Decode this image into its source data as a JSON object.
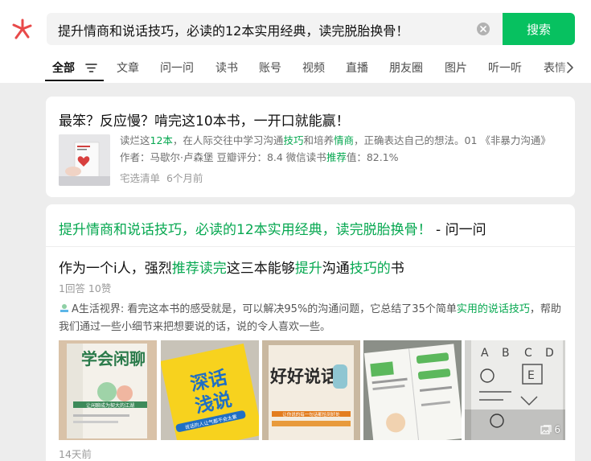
{
  "search": {
    "query": "提升情商和说话技巧，必读的12本实用经典，读完脱胎换骨！",
    "button_label": "搜索"
  },
  "tabs": [
    {
      "label": "全部",
      "active": true
    },
    {
      "label": "文章"
    },
    {
      "label": "问一问"
    },
    {
      "label": "读书"
    },
    {
      "label": "账号"
    },
    {
      "label": "视频"
    },
    {
      "label": "直播"
    },
    {
      "label": "朋友圈"
    },
    {
      "label": "图片"
    },
    {
      "label": "听一听"
    },
    {
      "label": "表情"
    }
  ],
  "result1": {
    "title": "最笨？反应慢？啃完这10本书，一开口就能赢！",
    "desc": [
      {
        "t": "读烂这"
      },
      {
        "t": "12本",
        "hl": true
      },
      {
        "t": "，在人际交往中学习沟通"
      },
      {
        "t": "技巧",
        "hl": true
      },
      {
        "t": "和培养"
      },
      {
        "t": "情商",
        "hl": true
      },
      {
        "t": "，正确表达自己的想法。01 《非暴力沟通》 作者：马歇尔·卢森堡 豆瓣评分：8.4 微信读书"
      },
      {
        "t": "推荐",
        "hl": true
      },
      {
        "t": "值：82.1%"
      }
    ],
    "source": "宅选清单",
    "time": "6个月前"
  },
  "result2": {
    "head_title": "提升情商和说话技巧，必读的12本实用经典，读完脱胎换骨！",
    "head_source": " - 问一问",
    "question": [
      {
        "t": "作为一个i人，强烈"
      },
      {
        "t": "推荐读完",
        "hl": true
      },
      {
        "t": "这三本能够"
      },
      {
        "t": "提升",
        "hl": true
      },
      {
        "t": "沟通"
      },
      {
        "t": "技巧的",
        "hl": true
      },
      {
        "t": "书"
      }
    ],
    "stats": "1回答 10赞",
    "answer": [
      {
        "t": "A生活视界: 看完这本书的感受就是，可以解决95%的沟通问题，它总结了35个简单"
      },
      {
        "t": "实用的说话技巧",
        "hl": true
      },
      {
        "t": "，帮助我们通过一些小细节来把想要说的话，说的令人喜欢一些。"
      }
    ],
    "photos": [
      {
        "icon": "book-cover-xuehui-xianliao",
        "cover_title": "学会闲聊",
        "cover_sub": "让闲聊成为契大的江湖"
      },
      {
        "icon": "book-cover-shenhua-qianshuo",
        "cover_title": "深话浅说",
        "cover_sub": "说话的人让气都不会太累"
      },
      {
        "icon": "book-cover-haohao-shuohua",
        "cover_title": "好好说话",
        "cover_sub": "让你说的每一句话都恰到好处"
      },
      {
        "icon": "book-page-green-illustration"
      },
      {
        "icon": "book-page-abc-sketch"
      }
    ],
    "photo_count": "6",
    "time": "14天前"
  },
  "colors": {
    "accent": "#07c160",
    "highlight": "#07a851",
    "logo": "#e84a4a"
  }
}
